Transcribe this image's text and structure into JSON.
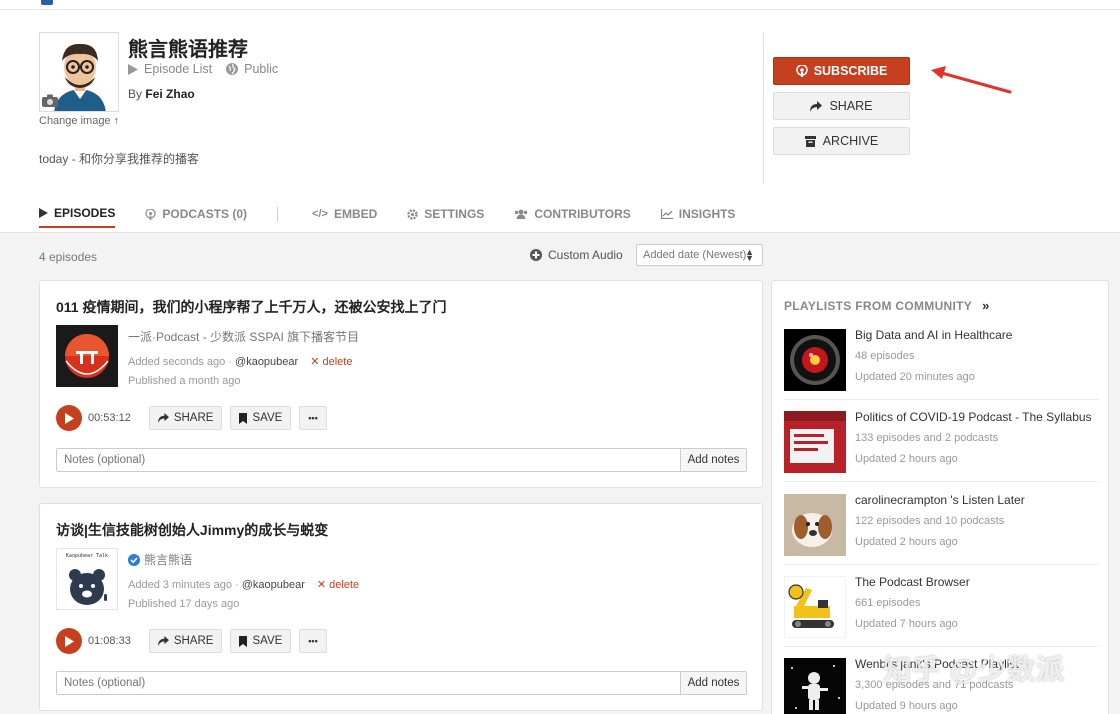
{
  "header": {
    "title": "熊言熊语推荐",
    "episode_list": "Episode List",
    "visibility": "Public",
    "by_label": "By",
    "author": "Fei Zhao",
    "change_image": "Change image",
    "description": "today - 和你分享我推荐的播客"
  },
  "actions": {
    "subscribe": "SUBSCRIBE",
    "share": "SHARE",
    "archive": "ARCHIVE"
  },
  "tabs": {
    "episodes": "EPISODES",
    "podcasts": "PODCASTS (0)",
    "embed": "EMBED",
    "settings": "SETTINGS",
    "contributors": "CONTRIBUTORS",
    "insights": "INSIGHTS"
  },
  "toolbar": {
    "episode_count": "4 episodes",
    "custom_audio": "Custom Audio",
    "sort": "Added date (Newest)"
  },
  "episodes": [
    {
      "title": "011 疫情期间，我们的小程序帮了上千万人，还被公安找上了门",
      "podcast": "一派·Podcast - 少数派 SSPAI 旗下播客节目",
      "added": "Added seconds ago · ",
      "added_by": "@kaopubear",
      "delete": "✕ delete",
      "published": "Published a month ago",
      "duration": "00:53:12",
      "share": "SHARE",
      "save": "SAVE",
      "more": "•••",
      "notes_placeholder": "Notes (optional)",
      "add_notes": "Add notes"
    },
    {
      "title": "访谈|生信技能树创始人Jimmy的成长与蜕变",
      "podcast": "熊言熊语",
      "added": "Added 3 minutes ago · ",
      "added_by": "@kaopubear",
      "delete": "✕ delete",
      "published": "Published 17 days ago",
      "duration": "01:08:33",
      "share": "SHARE",
      "save": "SAVE",
      "more": "•••",
      "notes_placeholder": "Notes (optional)",
      "add_notes": "Add notes",
      "art_text": "Kaopubear Talk"
    }
  ],
  "sidebar": {
    "title": "PLAYLISTS FROM COMMUNITY",
    "chevron": "»",
    "playlists": [
      {
        "name": "Big Data and AI in Healthcare",
        "count": "48 episodes",
        "updated": "Updated 20 minutes ago"
      },
      {
        "name": "Politics of COVID-19 Podcast - The Syllabus",
        "count": "133 episodes and 2 podcasts",
        "updated": "Updated 2 hours ago"
      },
      {
        "name": "carolinecrampton 's Listen Later",
        "count": "122 episodes and 10 podcasts",
        "updated": "Updated 2 hours ago"
      },
      {
        "name": "The Podcast Browser",
        "count": "661 episodes",
        "updated": "Updated 7 hours ago"
      },
      {
        "name": "Wenbi's jank's Podcast Playlist",
        "count": "3,300 episodes and 71 podcasts",
        "updated": "Updated 9 hours ago"
      }
    ]
  },
  "watermark": "知乎 @少数派",
  "colors": {
    "accent": "#c63f1e",
    "annotation_arrow": "#e0342a"
  }
}
